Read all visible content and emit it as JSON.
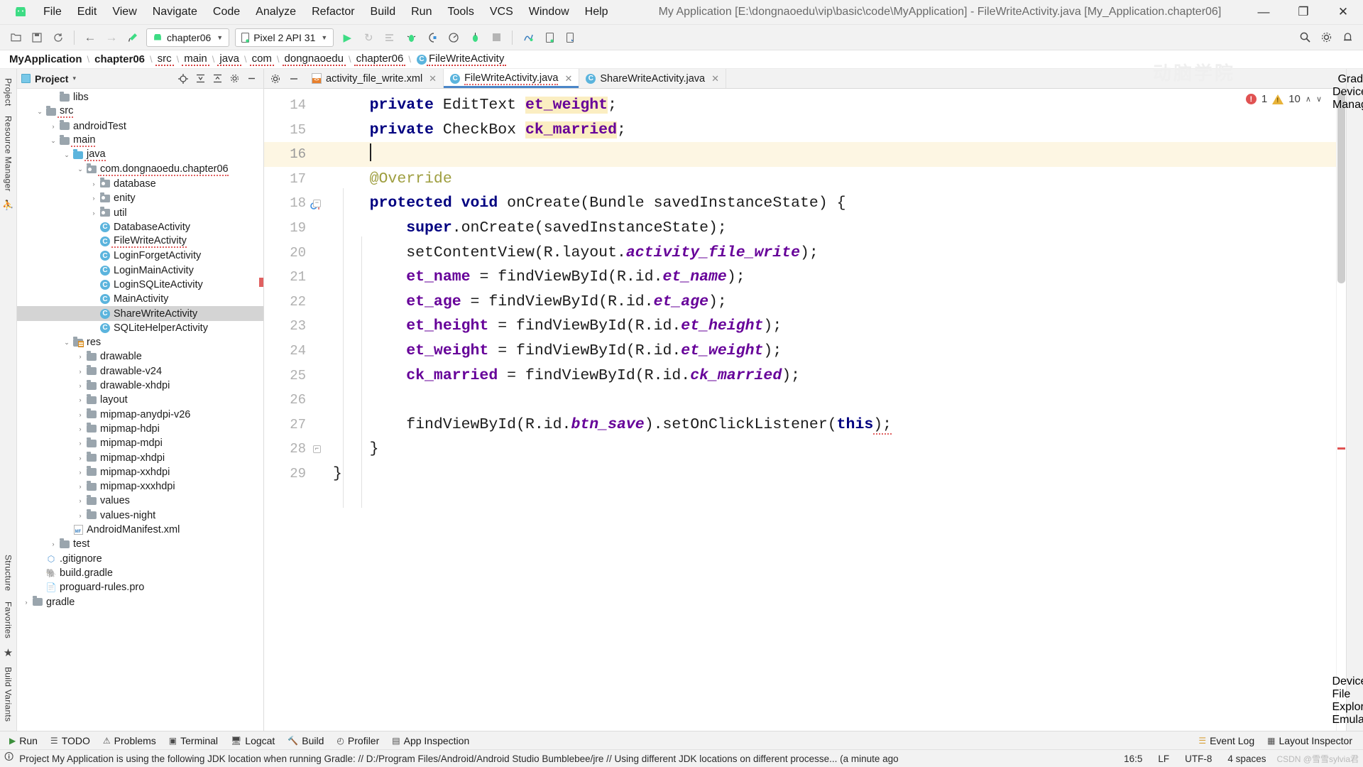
{
  "window": {
    "title": "My Application [E:\\dongnaoedu\\vip\\basic\\code\\MyApplication] - FileWriteActivity.java [My_Application.chapter06]",
    "minimize": "—",
    "maximize": "❐",
    "close": "✕",
    "watermark": "动脑学院"
  },
  "menu": {
    "items": [
      {
        "label": "File"
      },
      {
        "label": "Edit"
      },
      {
        "label": "View"
      },
      {
        "label": "Navigate"
      },
      {
        "label": "Code"
      },
      {
        "label": "Analyze"
      },
      {
        "label": "Refactor"
      },
      {
        "label": "Build"
      },
      {
        "label": "Run"
      },
      {
        "label": "Tools"
      },
      {
        "label": "VCS"
      },
      {
        "label": "Window"
      },
      {
        "label": "Help"
      }
    ]
  },
  "toolbar": {
    "icons_left": [
      "open-folder-icon",
      "save-all-icon",
      "sync-icon"
    ],
    "nav_back": "←",
    "nav_forward": "→",
    "build_hammer": "build-hammer-icon",
    "module_selector": "chapter06",
    "device_selector": "Pixel 2 API 31",
    "run_button": "▶",
    "rerun_button": "↻",
    "icons_right": [
      "apply-changes-icon",
      "debug-icon",
      "profile-icon",
      "coverage-icon",
      "attach-debugger-icon",
      "stop-icon",
      "sdk-manager-icon",
      "avd-manager-icon",
      "device-file-explorer-icon"
    ],
    "search_icon": "search-icon",
    "settings_icon": "gear-icon",
    "notifications_icon": "bell-icon"
  },
  "breadcrumb": {
    "items": [
      {
        "label": "MyApplication",
        "bold": true,
        "squiggle": false,
        "icon": ""
      },
      {
        "label": "chapter06",
        "bold": true,
        "squiggle": false,
        "icon": ""
      },
      {
        "label": "src",
        "bold": false,
        "squiggle": true,
        "icon": ""
      },
      {
        "label": "main",
        "bold": false,
        "squiggle": true,
        "icon": ""
      },
      {
        "label": "java",
        "bold": false,
        "squiggle": true,
        "icon": ""
      },
      {
        "label": "com",
        "bold": false,
        "squiggle": true,
        "icon": ""
      },
      {
        "label": "dongnaoedu",
        "bold": false,
        "squiggle": true,
        "icon": ""
      },
      {
        "label": "chapter06",
        "bold": false,
        "squiggle": true,
        "icon": ""
      },
      {
        "label": "FileWriteActivity",
        "bold": false,
        "squiggle": true,
        "icon": "class-icon"
      }
    ],
    "separator": "›"
  },
  "left_rail": {
    "items": [
      {
        "label": "Project",
        "type": "text"
      },
      {
        "label": "Resource Manager",
        "type": "text"
      },
      {
        "label": "accessibility-icon",
        "type": "icon",
        "glyph": "⛹"
      }
    ],
    "bottom_items": [
      {
        "label": "Structure",
        "type": "text"
      },
      {
        "label": "Favorites",
        "type": "text"
      },
      {
        "label": "favorites-star-icon",
        "type": "icon",
        "glyph": "★"
      },
      {
        "label": "Build Variants",
        "type": "text"
      }
    ]
  },
  "right_rail": {
    "items": [
      {
        "label": "Gradle",
        "type": "text"
      },
      {
        "label": "Device Manager",
        "type": "text"
      }
    ],
    "bottom_items": [
      {
        "label": "Device File Explorer",
        "type": "text"
      },
      {
        "label": "Emulator",
        "type": "text"
      }
    ]
  },
  "project_panel": {
    "title": "Project",
    "caret": "▾",
    "actions": [
      "locate-target-icon",
      "expand-all-icon",
      "collapse-all-icon",
      "settings-gear-icon",
      "hide-icon"
    ],
    "tree": [
      {
        "indent": 3,
        "arrow": "",
        "icon": "folder",
        "label": "libs",
        "selected": false,
        "squiggle": false
      },
      {
        "indent": 2,
        "arrow": "v",
        "icon": "folder",
        "label": "src",
        "selected": false,
        "squiggle": true
      },
      {
        "indent": 3,
        "arrow": ">",
        "icon": "folder",
        "label": "androidTest",
        "selected": false,
        "squiggle": false
      },
      {
        "indent": 3,
        "arrow": "v",
        "icon": "folder",
        "label": "main",
        "selected": false,
        "squiggle": true
      },
      {
        "indent": 4,
        "arrow": "v",
        "icon": "folder-blue",
        "label": "java",
        "selected": false,
        "squiggle": true
      },
      {
        "indent": 5,
        "arrow": "v",
        "icon": "package",
        "label": "com.dongnaoedu.chapter06",
        "selected": false,
        "squiggle": true
      },
      {
        "indent": 6,
        "arrow": ">",
        "icon": "package",
        "label": "database",
        "selected": false,
        "squiggle": false
      },
      {
        "indent": 6,
        "arrow": ">",
        "icon": "package",
        "label": "enity",
        "selected": false,
        "squiggle": false
      },
      {
        "indent": 6,
        "arrow": ">",
        "icon": "package",
        "label": "util",
        "selected": false,
        "squiggle": false
      },
      {
        "indent": 6,
        "arrow": "",
        "icon": "class",
        "label": "DatabaseActivity",
        "selected": false,
        "squiggle": false
      },
      {
        "indent": 6,
        "arrow": "",
        "icon": "class",
        "label": "FileWriteActivity",
        "selected": false,
        "squiggle": true
      },
      {
        "indent": 6,
        "arrow": "",
        "icon": "class",
        "label": "LoginForgetActivity",
        "selected": false,
        "squiggle": false
      },
      {
        "indent": 6,
        "arrow": "",
        "icon": "class",
        "label": "LoginMainActivity",
        "selected": false,
        "squiggle": false
      },
      {
        "indent": 6,
        "arrow": "",
        "icon": "class",
        "label": "LoginSQLiteActivity",
        "selected": false,
        "squiggle": false
      },
      {
        "indent": 6,
        "arrow": "",
        "icon": "class",
        "label": "MainActivity",
        "selected": false,
        "squiggle": false
      },
      {
        "indent": 6,
        "arrow": "",
        "icon": "class",
        "label": "ShareWriteActivity",
        "selected": true,
        "squiggle": false
      },
      {
        "indent": 6,
        "arrow": "",
        "icon": "class",
        "label": "SQLiteHelperActivity",
        "selected": false,
        "squiggle": false
      },
      {
        "indent": 4,
        "arrow": "v",
        "icon": "folder-res",
        "label": "res",
        "selected": false,
        "squiggle": false
      },
      {
        "indent": 5,
        "arrow": ">",
        "icon": "folder",
        "label": "drawable",
        "selected": false,
        "squiggle": false
      },
      {
        "indent": 5,
        "arrow": ">",
        "icon": "folder",
        "label": "drawable-v24",
        "selected": false,
        "squiggle": false
      },
      {
        "indent": 5,
        "arrow": ">",
        "icon": "folder",
        "label": "drawable-xhdpi",
        "selected": false,
        "squiggle": false
      },
      {
        "indent": 5,
        "arrow": ">",
        "icon": "folder",
        "label": "layout",
        "selected": false,
        "squiggle": false
      },
      {
        "indent": 5,
        "arrow": ">",
        "icon": "folder",
        "label": "mipmap-anydpi-v26",
        "selected": false,
        "squiggle": false
      },
      {
        "indent": 5,
        "arrow": ">",
        "icon": "folder",
        "label": "mipmap-hdpi",
        "selected": false,
        "squiggle": false
      },
      {
        "indent": 5,
        "arrow": ">",
        "icon": "folder",
        "label": "mipmap-mdpi",
        "selected": false,
        "squiggle": false
      },
      {
        "indent": 5,
        "arrow": ">",
        "icon": "folder",
        "label": "mipmap-xhdpi",
        "selected": false,
        "squiggle": false
      },
      {
        "indent": 5,
        "arrow": ">",
        "icon": "folder",
        "label": "mipmap-xxhdpi",
        "selected": false,
        "squiggle": false
      },
      {
        "indent": 5,
        "arrow": ">",
        "icon": "folder",
        "label": "mipmap-xxxhdpi",
        "selected": false,
        "squiggle": false
      },
      {
        "indent": 5,
        "arrow": ">",
        "icon": "folder",
        "label": "values",
        "selected": false,
        "squiggle": false
      },
      {
        "indent": 5,
        "arrow": ">",
        "icon": "folder",
        "label": "values-night",
        "selected": false,
        "squiggle": false
      },
      {
        "indent": 4,
        "arrow": "",
        "icon": "manifest",
        "label": "AndroidManifest.xml",
        "selected": false,
        "squiggle": false
      },
      {
        "indent": 3,
        "arrow": ">",
        "icon": "folder",
        "label": "test",
        "selected": false,
        "squiggle": false
      },
      {
        "indent": 2,
        "arrow": "",
        "icon": "gitignore",
        "label": ".gitignore",
        "selected": false,
        "squiggle": false
      },
      {
        "indent": 2,
        "arrow": "",
        "icon": "gradle",
        "label": "build.gradle",
        "selected": false,
        "squiggle": false
      },
      {
        "indent": 2,
        "arrow": "",
        "icon": "file",
        "label": "proguard-rules.pro",
        "selected": false,
        "squiggle": false
      },
      {
        "indent": 1,
        "arrow": ">",
        "icon": "folder",
        "label": "gradle",
        "selected": false,
        "squiggle": false
      }
    ]
  },
  "editor": {
    "tabs": [
      {
        "label": "activity_file_write.xml",
        "icon": "xml-file-icon",
        "active": false,
        "squiggle": false,
        "close": "✕"
      },
      {
        "label": "FileWriteActivity.java",
        "icon": "java-class-icon",
        "active": true,
        "squiggle": true,
        "close": "✕"
      },
      {
        "label": "ShareWriteActivity.java",
        "icon": "java-class-icon",
        "active": false,
        "squiggle": false,
        "close": "✕"
      }
    ],
    "inspections": {
      "error_count": "1",
      "warning_count": "10",
      "error_glyph": "!",
      "up_arrow": "∧",
      "caret": "∨"
    },
    "first_line_number": 14,
    "lines": [
      {
        "n": "14",
        "current": false,
        "tokens": [
          {
            "t": "    ",
            "c": "plain"
          },
          {
            "t": "private",
            "c": "kw"
          },
          {
            "t": " ",
            "c": "plain"
          },
          {
            "t": "EditText",
            "c": "ty"
          },
          {
            "t": " ",
            "c": "plain"
          },
          {
            "t": "et_weight",
            "c": "fld hl"
          },
          {
            "t": ";",
            "c": "plain"
          }
        ]
      },
      {
        "n": "15",
        "current": false,
        "tokens": [
          {
            "t": "    ",
            "c": "plain"
          },
          {
            "t": "private",
            "c": "kw"
          },
          {
            "t": " ",
            "c": "plain"
          },
          {
            "t": "CheckBox",
            "c": "ty"
          },
          {
            "t": " ",
            "c": "plain"
          },
          {
            "t": "ck_married",
            "c": "fld hl"
          },
          {
            "t": ";",
            "c": "plain"
          }
        ]
      },
      {
        "n": "16",
        "current": true,
        "caret": true,
        "tokens": [
          {
            "t": "    ",
            "c": "plain"
          }
        ]
      },
      {
        "n": "17",
        "current": false,
        "tokens": [
          {
            "t": "    ",
            "c": "plain"
          },
          {
            "t": "@Override",
            "c": "ann"
          }
        ]
      },
      {
        "n": "18",
        "current": false,
        "gutter_icon": "override-method-icon",
        "fold": true,
        "tokens": [
          {
            "t": "    ",
            "c": "plain"
          },
          {
            "t": "protected void",
            "c": "kw"
          },
          {
            "t": " onCreate(Bundle savedInstanceState) {",
            "c": "plain"
          }
        ]
      },
      {
        "n": "19",
        "current": false,
        "tokens": [
          {
            "t": "        ",
            "c": "plain"
          },
          {
            "t": "super",
            "c": "kw"
          },
          {
            "t": ".onCreate(savedInstanceState);",
            "c": "plain"
          }
        ]
      },
      {
        "n": "20",
        "current": false,
        "tokens": [
          {
            "t": "        setContentView(R.layout.",
            "c": "plain"
          },
          {
            "t": "activity_file_write",
            "c": "stat"
          },
          {
            "t": ");",
            "c": "plain"
          }
        ]
      },
      {
        "n": "21",
        "current": false,
        "tokens": [
          {
            "t": "        ",
            "c": "plain"
          },
          {
            "t": "et_name",
            "c": "fld"
          },
          {
            "t": " = findViewById(R.id.",
            "c": "plain"
          },
          {
            "t": "et_name",
            "c": "stat"
          },
          {
            "t": ");",
            "c": "plain"
          }
        ]
      },
      {
        "n": "22",
        "current": false,
        "tokens": [
          {
            "t": "        ",
            "c": "plain"
          },
          {
            "t": "et_age",
            "c": "fld"
          },
          {
            "t": " = findViewById(R.id.",
            "c": "plain"
          },
          {
            "t": "et_age",
            "c": "stat"
          },
          {
            "t": ");",
            "c": "plain"
          }
        ]
      },
      {
        "n": "23",
        "current": false,
        "tokens": [
          {
            "t": "        ",
            "c": "plain"
          },
          {
            "t": "et_height",
            "c": "fld"
          },
          {
            "t": " = findViewById(R.id.",
            "c": "plain"
          },
          {
            "t": "et_height",
            "c": "stat"
          },
          {
            "t": ");",
            "c": "plain"
          }
        ]
      },
      {
        "n": "24",
        "current": false,
        "tokens": [
          {
            "t": "        ",
            "c": "plain"
          },
          {
            "t": "et_weight",
            "c": "fld"
          },
          {
            "t": " = findViewById(R.id.",
            "c": "plain"
          },
          {
            "t": "et_weight",
            "c": "stat"
          },
          {
            "t": ");",
            "c": "plain"
          }
        ]
      },
      {
        "n": "25",
        "current": false,
        "tokens": [
          {
            "t": "        ",
            "c": "plain"
          },
          {
            "t": "ck_married",
            "c": "fld"
          },
          {
            "t": " = findViewById(R.id.",
            "c": "plain"
          },
          {
            "t": "ck_married",
            "c": "stat"
          },
          {
            "t": ");",
            "c": "plain"
          }
        ]
      },
      {
        "n": "26",
        "current": false,
        "tokens": [
          {
            "t": " ",
            "c": "plain"
          }
        ]
      },
      {
        "n": "27",
        "current": false,
        "tokens": [
          {
            "t": "        findViewById(R.id.",
            "c": "plain"
          },
          {
            "t": "btn_save",
            "c": "stat"
          },
          {
            "t": ").setOnClickListener(",
            "c": "plain"
          },
          {
            "t": "this",
            "c": "kw"
          },
          {
            "t": ");",
            "c": "plain err"
          }
        ]
      },
      {
        "n": "28",
        "current": false,
        "fold_end": true,
        "tokens": [
          {
            "t": "    }",
            "c": "plain"
          }
        ]
      },
      {
        "n": "29",
        "current": false,
        "tokens": [
          {
            "t": "}",
            "c": "plain"
          }
        ]
      }
    ]
  },
  "tool_windows": {
    "left": [
      {
        "label": "Run",
        "icon": "run-icon"
      },
      {
        "label": "TODO",
        "icon": "todo-icon"
      },
      {
        "label": "Problems",
        "icon": "problems-icon"
      },
      {
        "label": "Terminal",
        "icon": "terminal-icon"
      },
      {
        "label": "Logcat",
        "icon": "logcat-icon"
      },
      {
        "label": "Build",
        "icon": "build-icon"
      },
      {
        "label": "Profiler",
        "icon": "profiler-icon"
      },
      {
        "label": "App Inspection",
        "icon": "app-inspection-icon"
      }
    ],
    "right": [
      {
        "label": "Event Log",
        "icon": "event-log-icon"
      },
      {
        "label": "Layout Inspector",
        "icon": "layout-inspector-icon"
      }
    ]
  },
  "status_bar": {
    "message": "Project My Application is using the following JDK location when running Gradle: // D:/Program Files/Android/Android Studio Bumblebee/jre // Using different JDK locations on different processe... (a minute ago",
    "caret_position": "16:5",
    "line_separator": "LF",
    "encoding": "UTF-8",
    "indent": "4 spaces",
    "watermark": "CSDN @雪雪sylvia君"
  }
}
